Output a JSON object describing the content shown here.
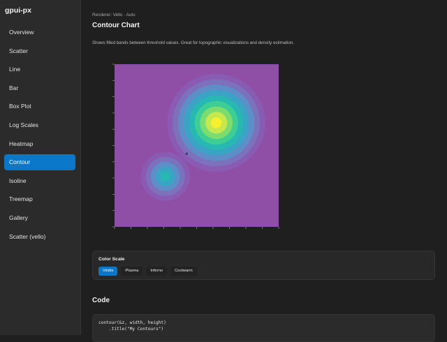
{
  "app": {
    "title": "gpui-px"
  },
  "sidebar": {
    "items": [
      {
        "label": "Overview",
        "active": false
      },
      {
        "label": "Scatter",
        "active": false
      },
      {
        "label": "Line",
        "active": false
      },
      {
        "label": "Bar",
        "active": false
      },
      {
        "label": "Box Plot",
        "active": false
      },
      {
        "label": "Log Scales",
        "active": false
      },
      {
        "label": "Heatmap",
        "active": false
      },
      {
        "label": "Contour",
        "active": true
      },
      {
        "label": "Isoline",
        "active": false
      },
      {
        "label": "Treemap",
        "active": false
      },
      {
        "label": "Gallery",
        "active": false
      },
      {
        "label": "Scatter (vello)",
        "active": false
      }
    ]
  },
  "main": {
    "renderer": "Renderer: Vello · Auto",
    "title": "Contour Chart",
    "description": "Shows filled bands between threshold values. Great for topographic visualizations and density estimation."
  },
  "color_scale": {
    "title": "Color Scale",
    "options": [
      {
        "label": "Viridis",
        "active": true
      },
      {
        "label": "Plasma",
        "active": false
      },
      {
        "label": "Inferno",
        "active": false
      },
      {
        "label": "Coolwarm",
        "active": false
      }
    ]
  },
  "code": {
    "heading": "Code",
    "lines": [
      "contour(&z, width, height)",
      "    .title(\"My Contours\")"
    ]
  },
  "colors": {
    "accent": "#0a77c9",
    "background": "#1f1f1f",
    "sidebar": "#2b2b2b",
    "plot_background": "#8f4fa7"
  },
  "chart_data": {
    "type": "heatmap",
    "style": "filled-contour",
    "title": "",
    "xlabel": "",
    "ylabel": "",
    "color_scale": "Viridis",
    "bands": [
      "#8f4fa7",
      "#8a5bb3",
      "#7c72bc",
      "#5e8ec8",
      "#3aa4c5",
      "#27b8b4",
      "#3dce95",
      "#7bdc6f",
      "#c6e84f",
      "#f5f12e"
    ],
    "peaks": [
      {
        "x": 0.62,
        "y": 0.64,
        "peak_level": 9
      },
      {
        "x": 0.31,
        "y": 0.31,
        "peak_level": 5
      }
    ]
  }
}
